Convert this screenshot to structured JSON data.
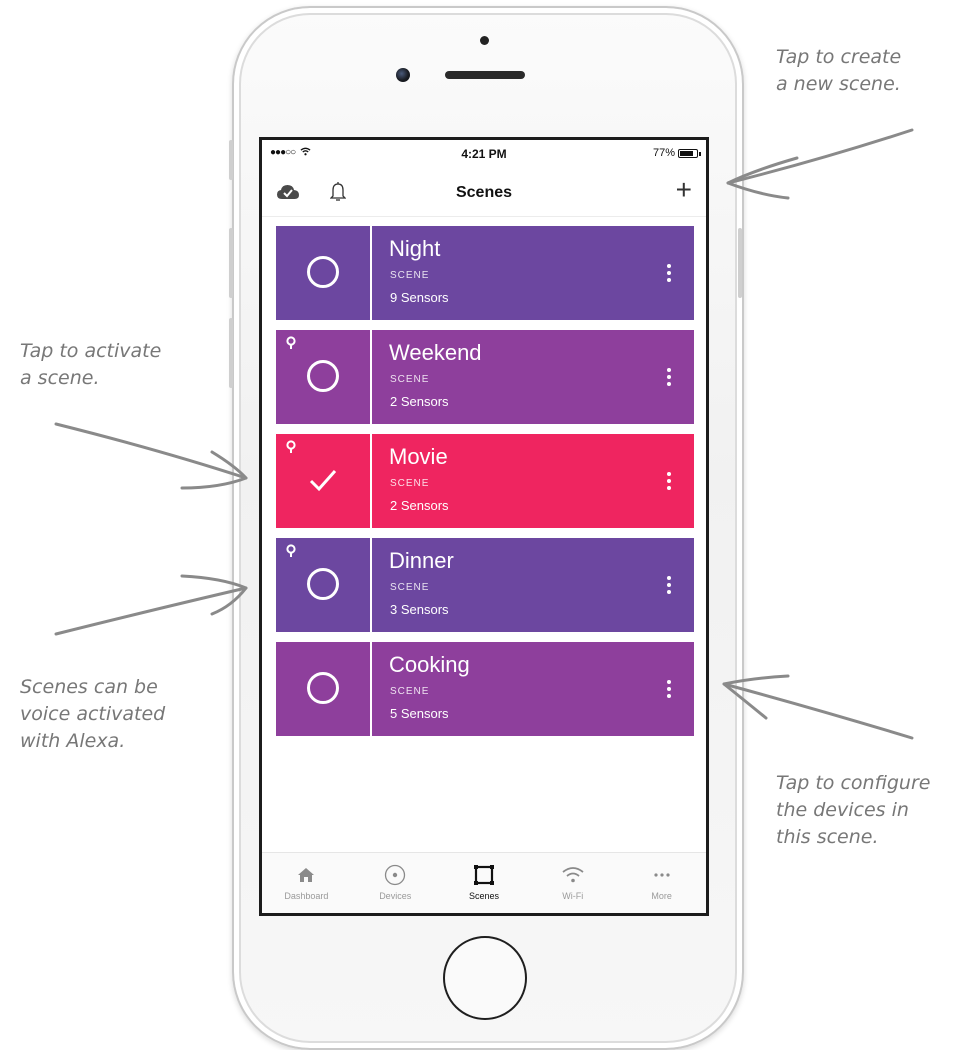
{
  "status_bar": {
    "signal": "●●●○○",
    "time": "4:21 PM",
    "battery": "77%"
  },
  "nav": {
    "title": "Scenes",
    "add_symbol": "+"
  },
  "scenes": [
    {
      "name": "Night",
      "type": "SCENE",
      "count": "9 Sensors",
      "color": "#6c47a0",
      "active": false,
      "voice": false
    },
    {
      "name": "Weekend",
      "type": "SCENE",
      "count": "2 Sensors",
      "color": "#8e3f9c",
      "active": false,
      "voice": true
    },
    {
      "name": "Movie",
      "type": "SCENE",
      "count": "2 Sensors",
      "color": "#ef2560",
      "active": true,
      "voice": true
    },
    {
      "name": "Dinner",
      "type": "SCENE",
      "count": "3 Sensors",
      "color": "#6c47a0",
      "active": false,
      "voice": true
    },
    {
      "name": "Cooking",
      "type": "SCENE",
      "count": "5 Sensors",
      "color": "#8e3f9c",
      "active": false,
      "voice": false
    }
  ],
  "tabs": [
    {
      "label": "Dashboard",
      "icon": "home-icon",
      "active": false
    },
    {
      "label": "Devices",
      "icon": "devices-icon",
      "active": false
    },
    {
      "label": "Scenes",
      "icon": "scenes-icon",
      "active": true
    },
    {
      "label": "Wi-Fi",
      "icon": "wifi-icon",
      "active": false
    },
    {
      "label": "More",
      "icon": "more-icon",
      "active": false
    }
  ],
  "annotations": {
    "create": "Tap to create\na new scene.",
    "activate": "Tap to activate\na scene.",
    "voice": "Scenes can be\nvoice activated\nwith Alexa.",
    "configure": "Tap to configure\nthe devices in\nthis scene."
  }
}
